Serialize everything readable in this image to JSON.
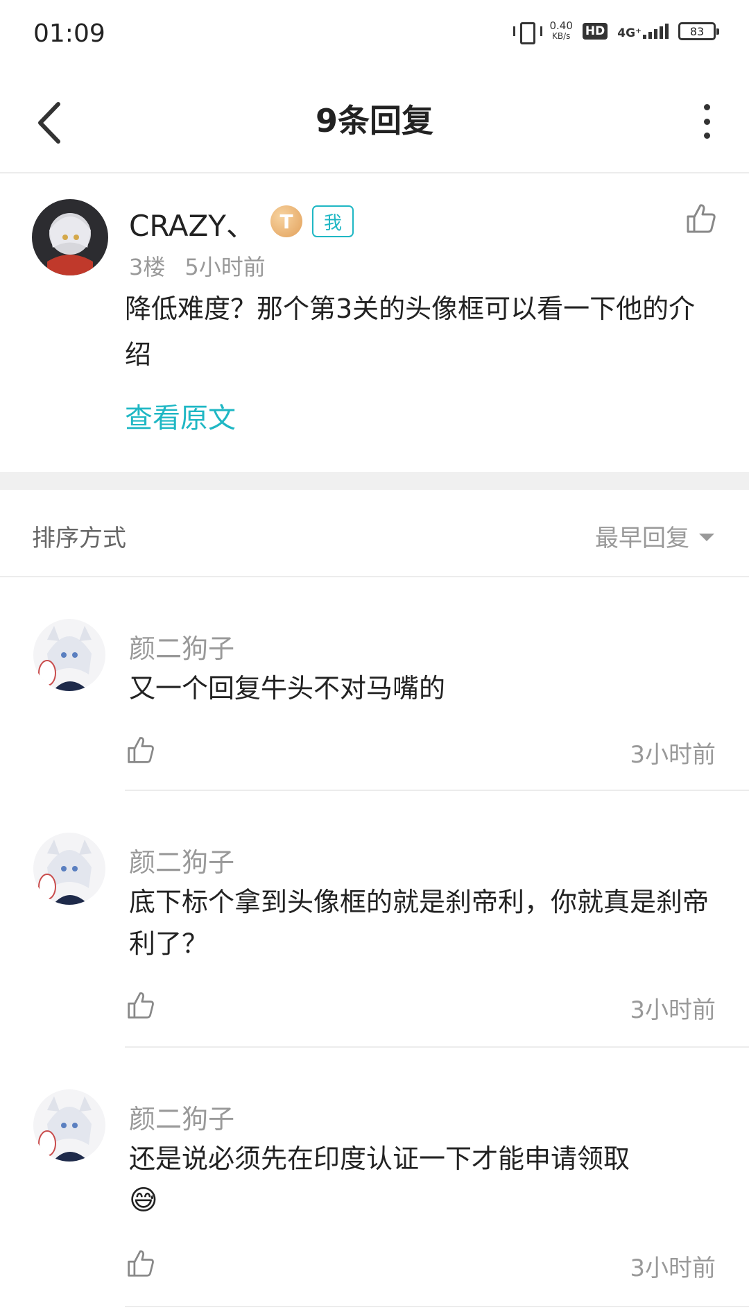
{
  "status_bar": {
    "time": "01:09",
    "speed_value": "0.40",
    "speed_unit": "KB/s",
    "hd": "HD",
    "network": "4G⁺",
    "battery": "83"
  },
  "header": {
    "title": "9条回复"
  },
  "main_post": {
    "username": "CRAZY、",
    "coin_badge": "T",
    "me_badge": "我",
    "floor": "3楼",
    "time": "5小时前",
    "content": "降低难度？那个第3关的头像框可以看一下他的介绍",
    "view_original": "查看原文"
  },
  "sort": {
    "label": "排序方式",
    "value": "最早回复"
  },
  "replies": [
    {
      "username": "颜二狗子",
      "content": "又一个回复牛头不对马嘴的",
      "time": "3小时前"
    },
    {
      "username": "颜二狗子",
      "content": "底下标个拿到头像框的就是刹帝利，你就真是刹帝利了？",
      "time": "3小时前"
    },
    {
      "username": "颜二狗子",
      "content": "还是说必须先在印度认证一下才能申请领取",
      "emoji": "😅",
      "time": "3小时前"
    }
  ],
  "icons": [
    "back-arrow-icon",
    "more-vertical-icon",
    "thumbs-up-icon",
    "caret-down-icon"
  ],
  "colors": {
    "accent": "#1fb7c4",
    "text": "#222222",
    "muted": "#999999"
  }
}
